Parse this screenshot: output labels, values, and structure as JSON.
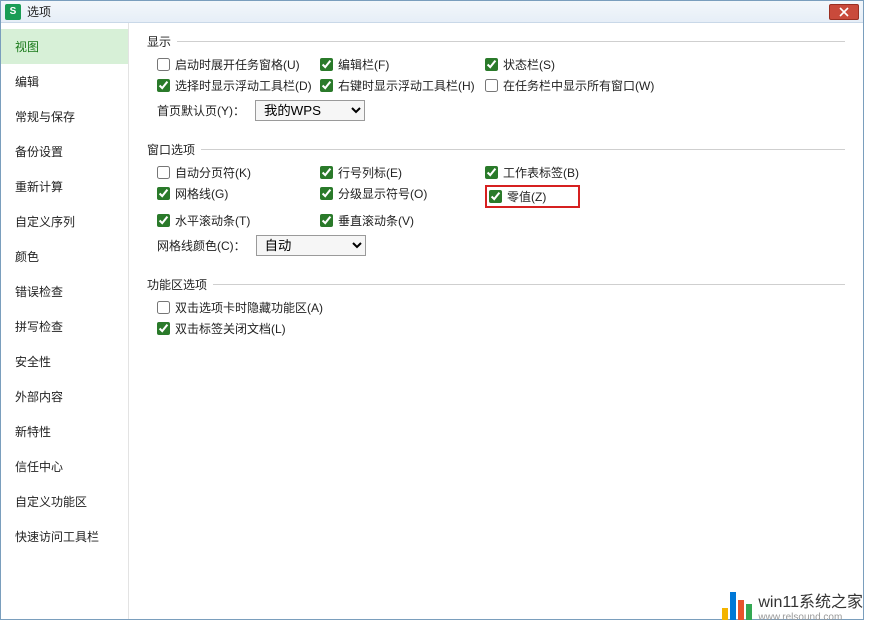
{
  "titlebar": {
    "app_icon_letter": "S",
    "title": "选项"
  },
  "sidebar": {
    "items": [
      {
        "label": "视图",
        "active": true
      },
      {
        "label": "编辑"
      },
      {
        "label": "常规与保存"
      },
      {
        "label": "备份设置"
      },
      {
        "label": "重新计算"
      },
      {
        "label": "自定义序列"
      },
      {
        "label": "颜色"
      },
      {
        "label": "错误检查"
      },
      {
        "label": "拼写检查"
      },
      {
        "label": "安全性"
      },
      {
        "label": "外部内容"
      },
      {
        "label": "新特性"
      },
      {
        "label": "信任中心"
      },
      {
        "label": "自定义功能区"
      },
      {
        "label": "快速访问工具栏"
      }
    ]
  },
  "groups": {
    "display": {
      "legend": "显示",
      "items": {
        "startup_taskpane": {
          "label": "启动时展开任务窗格(U)",
          "checked": false
        },
        "formula_bar": {
          "label": "编辑栏(F)",
          "checked": true
        },
        "status_bar": {
          "label": "状态栏(S)",
          "checked": true
        },
        "show_float_toolbar": {
          "label": "选择时显示浮动工具栏(D)",
          "checked": true
        },
        "rclick_float_toolbar": {
          "label": "右键时显示浮动工具栏(H)",
          "checked": true
        },
        "show_all_in_taskbar": {
          "label": "在任务栏中显示所有窗口(W)",
          "checked": false
        }
      },
      "home_tab": {
        "label": "首页默认页(Y)：",
        "value": "我的WPS"
      }
    },
    "window_options": {
      "legend": "窗口选项",
      "items": {
        "auto_pagebreak": {
          "label": "自动分页符(K)",
          "checked": false
        },
        "row_col_headers": {
          "label": "行号列标(E)",
          "checked": true
        },
        "sheet_tabs": {
          "label": "工作表标签(B)",
          "checked": true
        },
        "gridlines": {
          "label": "网格线(G)",
          "checked": true
        },
        "outline_symbols": {
          "label": "分级显示符号(O)",
          "checked": true
        },
        "zero_values": {
          "label": "零值(Z)",
          "checked": true,
          "highlight": true
        },
        "hscroll": {
          "label": "水平滚动条(T)",
          "checked": true
        },
        "vscroll": {
          "label": "垂直滚动条(V)",
          "checked": true
        }
      },
      "grid_color": {
        "label": "网格线颜色(C)：",
        "value": "自动"
      }
    },
    "ribbon": {
      "legend": "功能区选项",
      "items": {
        "dblclick_hide": {
          "label": "双击选项卡时隐藏功能区(A)",
          "checked": false
        },
        "dblclick_close": {
          "label": "双击标签关闭文档(L)",
          "checked": true
        }
      }
    }
  },
  "watermark": {
    "line1": "win11系统之家",
    "line2": "www.relsound.com"
  }
}
